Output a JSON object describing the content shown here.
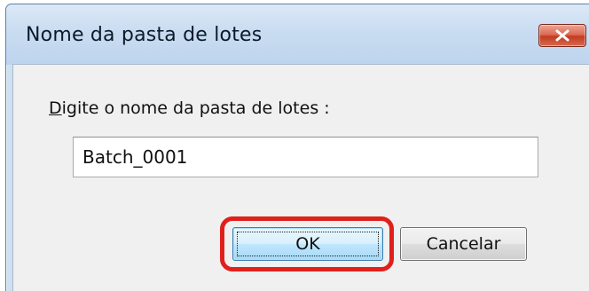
{
  "window": {
    "title": "Nome da pasta de lotes",
    "close_icon": "close-x-icon",
    "close_color": "#c8412a",
    "titlebar_color": "#c9dcf1"
  },
  "dialog": {
    "prompt_accel": "D",
    "prompt_rest": "igite o nome da pasta de lotes :",
    "input_value": "Batch_0001",
    "ok_label": "OK",
    "cancel_label": "Cancelar"
  },
  "annotation": {
    "highlight_color": "#e0201b",
    "highlight_target": "ok-button"
  }
}
